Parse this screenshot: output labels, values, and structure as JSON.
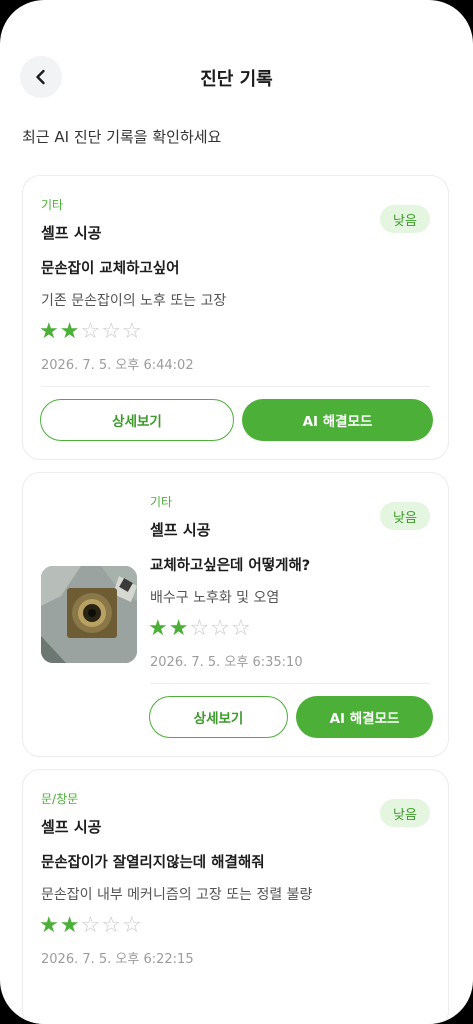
{
  "header": {
    "title": "진단 기록"
  },
  "subtitle": "최근 AI 진단 기록을 확인하세요",
  "records": [
    {
      "category": "기타",
      "service": "셀프 시공",
      "severity": "낮음",
      "question": "문손잡이 교체하고싶어",
      "diagnosis": "기존 문손잡이의 노후 또는 고장",
      "rating": 2,
      "max_rating": 5,
      "date": "2026. 7. 5. 오후 6:44:02",
      "detail_label": "상세보기",
      "ai_label": "AI 해결모드"
    },
    {
      "category": "기타",
      "service": "셀프 시공",
      "severity": "낮음",
      "question": "교체하고싶은데 어떻게해?",
      "diagnosis": "배수구 노후화 및 오염",
      "rating": 2,
      "max_rating": 5,
      "date": "2026. 7. 5. 오후 6:35:10",
      "detail_label": "상세보기",
      "ai_label": "AI 해결모드",
      "has_image": true
    },
    {
      "category": "문/창문",
      "service": "셀프 시공",
      "severity": "낮음",
      "question": "문손잡이가 잘열리지않는데 해결해줘",
      "diagnosis": "문손잡이 내부 메커니즘의 고장 또는 정렬 불량",
      "rating": 2,
      "max_rating": 5,
      "date": "2026. 7. 5. 오후 6:22:15"
    }
  ],
  "colors": {
    "accent": "#4caf38",
    "badge_bg": "#e4f5e0",
    "star_empty": "#c9c9c9"
  }
}
